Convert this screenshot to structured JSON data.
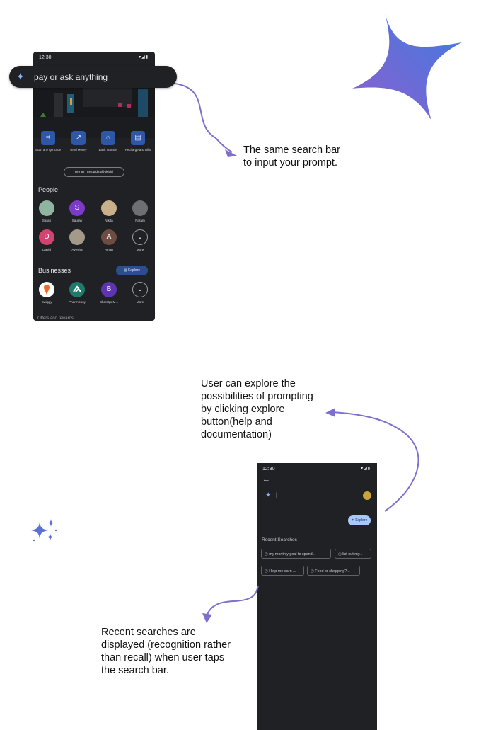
{
  "phone1": {
    "status": {
      "time": "12:30",
      "icons": "▾◢▮"
    },
    "search": {
      "placeholder_text": "pay or ask anything",
      "icon": "gemini-star-icon"
    },
    "quick_actions": [
      {
        "label": "Scan any QR code",
        "icon": "qr-scan-icon",
        "glyph": "⌗"
      },
      {
        "label": "send Money",
        "icon": "send-money-icon",
        "glyph": "↗"
      },
      {
        "label": "Bank Transfer",
        "icon": "bank-icon",
        "glyph": "⌂"
      },
      {
        "label": "Recharge and Bills",
        "icon": "bill-icon",
        "glyph": "▤"
      }
    ],
    "upi_id": "UPI ID : myupid24@okicici",
    "people_title": "People",
    "people": [
      {
        "name": "Sarah",
        "initial": "",
        "color": "#8fb5a0"
      },
      {
        "name": "Saurav",
        "initial": "S",
        "color": "#7c3ac9"
      },
      {
        "name": "Nikita",
        "initial": "",
        "color": "#c9b08a"
      },
      {
        "name": "Param",
        "initial": "",
        "color": "#6d6f73"
      },
      {
        "name": "David",
        "initial": "D",
        "color": "#d2446f"
      },
      {
        "name": "Ayesha",
        "initial": "",
        "color": "#a49a8a"
      },
      {
        "name": "Aman",
        "initial": "A",
        "color": "#6d4c41"
      },
      {
        "name": "More",
        "initial": "⌄",
        "color": "#202124"
      }
    ],
    "businesses_title": "Businesses",
    "explore_label": "Explore",
    "businesses": [
      {
        "name": "Swiggy",
        "initial": "",
        "color": "#ffffff"
      },
      {
        "name": "PharmEasy",
        "initial": "",
        "color": "#1f7a6b"
      },
      {
        "name": "BharatpeM...",
        "initial": "B",
        "color": "#5e35b1"
      },
      {
        "name": "More",
        "initial": "⌄",
        "color": "#202124"
      }
    ],
    "cut_text": "Offers and rewards"
  },
  "notes": {
    "search_bar": "The same search bar to input your prompt.",
    "explore": "User can explore the possibilities of prompting by clicking explore button(help and documentation)",
    "recent": "Recent searches are displayed (recognition rather than recall) when user taps the search bar."
  },
  "phone2": {
    "status": {
      "time": "12:30",
      "icons": "▾◢▮"
    },
    "back_icon": "back-arrow-icon",
    "search_value": "|",
    "explore_label": "Explore",
    "recent_title": "Recent Searches",
    "recent_chips": [
      "my monthly goal to spend...",
      "list out my...",
      "Help me earn ...",
      "Food or shopping?..."
    ]
  },
  "colors": {
    "accent_purple": "#7c6fce",
    "phone_bg": "#202124",
    "blue_button": "#2f57a8"
  }
}
